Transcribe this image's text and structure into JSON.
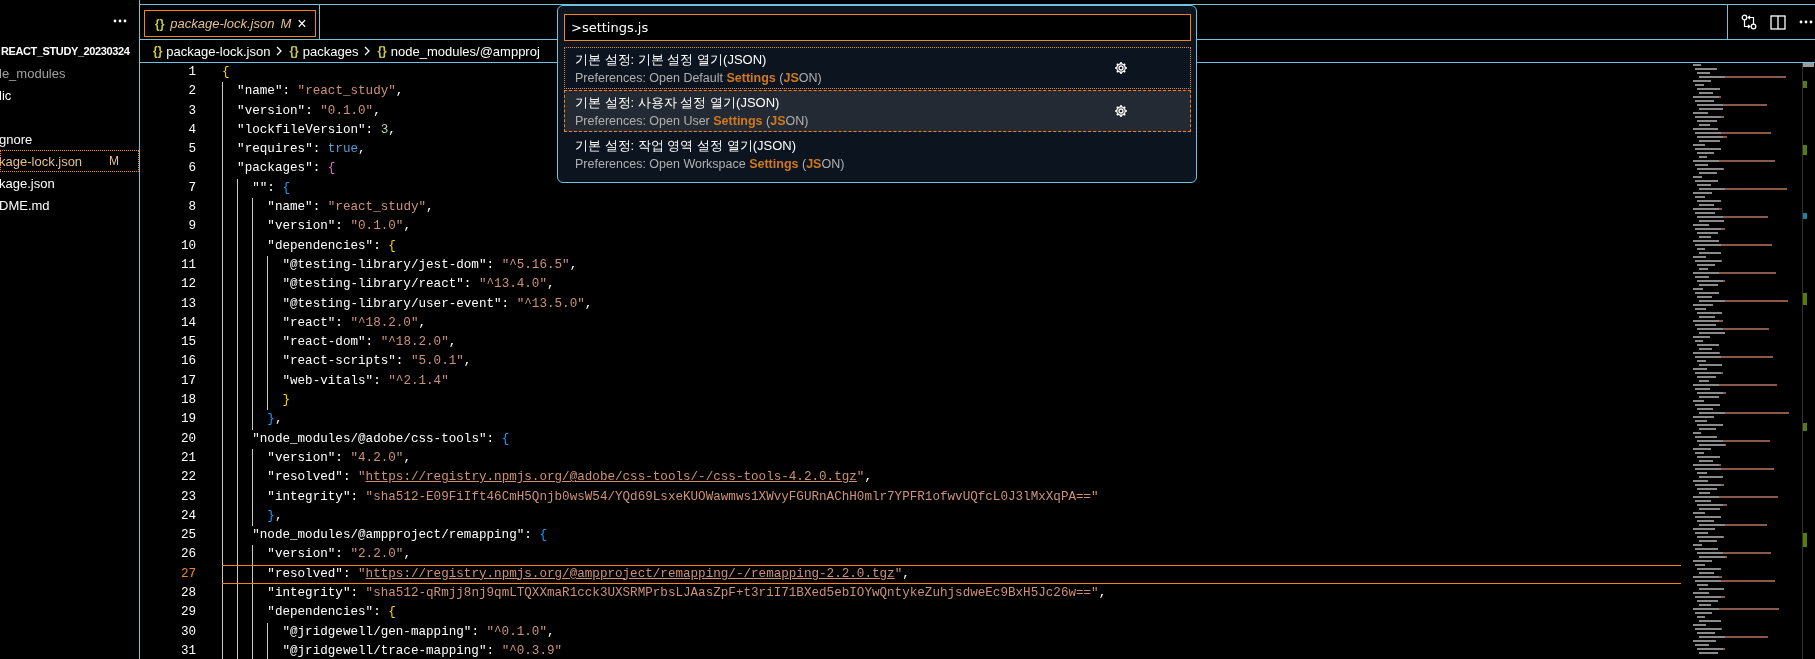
{
  "sidebar": {
    "title": "REACT_STUDY_20230324",
    "items": [
      {
        "label": "le_modules",
        "kind": "ignored",
        "selected": false
      },
      {
        "label": "lic",
        "kind": "plain",
        "selected": false
      },
      {
        "label": "gnore",
        "kind": "plain",
        "selected": false
      },
      {
        "label": "kage-lock.json",
        "kind": "modified",
        "badge": "M",
        "selected": true
      },
      {
        "label": "kage.json",
        "kind": "plain",
        "selected": false
      },
      {
        "label": "DME.md",
        "kind": "plain",
        "selected": false
      }
    ]
  },
  "tabs": [
    {
      "icon": "{}",
      "label": "package-lock.json",
      "badge": "M",
      "close": "×",
      "selected": true
    }
  ],
  "breadcrumbs": [
    {
      "icon": "{}",
      "label": "package-lock.json"
    },
    {
      "icon": "{}",
      "label": "packages"
    },
    {
      "icon": "{}",
      "label": "node_modules/@ampproj"
    }
  ],
  "editor": {
    "lines": [
      {
        "number": "1",
        "current": false,
        "tokens": [
          {
            "kind": "open",
            "text": "{"
          }
        ]
      },
      {
        "number": "2",
        "current": false,
        "tokens": [
          {
            "kind": "key",
            "text": "\"name\""
          },
          {
            "kind": "punct",
            "text": ": "
          },
          {
            "kind": "str",
            "text": "\"react_study\""
          },
          {
            "kind": "punct",
            "text": ","
          }
        ]
      },
      {
        "number": "3",
        "current": false,
        "tokens": [
          {
            "kind": "key",
            "text": "\"version\""
          },
          {
            "kind": "punct",
            "text": ": "
          },
          {
            "kind": "str",
            "text": "\"0.1.0\""
          },
          {
            "kind": "punct",
            "text": ","
          }
        ]
      },
      {
        "number": "4",
        "current": false,
        "tokens": [
          {
            "kind": "key",
            "text": "\"lockfileVersion\""
          },
          {
            "kind": "punct",
            "text": ": "
          },
          {
            "kind": "num",
            "text": "3"
          },
          {
            "kind": "punct",
            "text": ","
          }
        ]
      },
      {
        "number": "5",
        "current": false,
        "tokens": [
          {
            "kind": "key",
            "text": "\"requires\""
          },
          {
            "kind": "punct",
            "text": ": "
          },
          {
            "kind": "bool",
            "text": "true"
          },
          {
            "kind": "punct",
            "text": ","
          }
        ]
      },
      {
        "number": "6",
        "current": false,
        "tokens": [
          {
            "kind": "key",
            "text": "\"packages\""
          },
          {
            "kind": "punct",
            "text": ": "
          },
          {
            "kind": "open",
            "text": "{"
          }
        ]
      },
      {
        "number": "7",
        "current": false,
        "tokens": [
          {
            "kind": "key",
            "text": "\"\""
          },
          {
            "kind": "punct",
            "text": ": "
          },
          {
            "kind": "open",
            "text": "{"
          }
        ]
      },
      {
        "number": "8",
        "current": false,
        "tokens": [
          {
            "kind": "key",
            "text": "\"name\""
          },
          {
            "kind": "punct",
            "text": ": "
          },
          {
            "kind": "str",
            "text": "\"react_study\""
          },
          {
            "kind": "punct",
            "text": ","
          }
        ]
      },
      {
        "number": "9",
        "current": false,
        "tokens": [
          {
            "kind": "key",
            "text": "\"version\""
          },
          {
            "kind": "punct",
            "text": ": "
          },
          {
            "kind": "str",
            "text": "\"0.1.0\""
          },
          {
            "kind": "punct",
            "text": ","
          }
        ]
      },
      {
        "number": "10",
        "current": false,
        "tokens": [
          {
            "kind": "key",
            "text": "\"dependencies\""
          },
          {
            "kind": "punct",
            "text": ": "
          },
          {
            "kind": "open",
            "text": "{"
          }
        ]
      },
      {
        "number": "11",
        "current": false,
        "tokens": [
          {
            "kind": "key",
            "text": "\"@testing-library/jest-dom\""
          },
          {
            "kind": "punct",
            "text": ": "
          },
          {
            "kind": "str",
            "text": "\"^5.16.5\""
          },
          {
            "kind": "punct",
            "text": ","
          }
        ]
      },
      {
        "number": "12",
        "current": false,
        "tokens": [
          {
            "kind": "key",
            "text": "\"@testing-library/react\""
          },
          {
            "kind": "punct",
            "text": ": "
          },
          {
            "kind": "str",
            "text": "\"^13.4.0\""
          },
          {
            "kind": "punct",
            "text": ","
          }
        ]
      },
      {
        "number": "13",
        "current": false,
        "tokens": [
          {
            "kind": "key",
            "text": "\"@testing-library/user-event\""
          },
          {
            "kind": "punct",
            "text": ": "
          },
          {
            "kind": "str",
            "text": "\"^13.5.0\""
          },
          {
            "kind": "punct",
            "text": ","
          }
        ]
      },
      {
        "number": "14",
        "current": false,
        "tokens": [
          {
            "kind": "key",
            "text": "\"react\""
          },
          {
            "kind": "punct",
            "text": ": "
          },
          {
            "kind": "str",
            "text": "\"^18.2.0\""
          },
          {
            "kind": "punct",
            "text": ","
          }
        ]
      },
      {
        "number": "15",
        "current": false,
        "tokens": [
          {
            "kind": "key",
            "text": "\"react-dom\""
          },
          {
            "kind": "punct",
            "text": ": "
          },
          {
            "kind": "str",
            "text": "\"^18.2.0\""
          },
          {
            "kind": "punct",
            "text": ","
          }
        ]
      },
      {
        "number": "16",
        "current": false,
        "tokens": [
          {
            "kind": "key",
            "text": "\"react-scripts\""
          },
          {
            "kind": "punct",
            "text": ": "
          },
          {
            "kind": "str",
            "text": "\"5.0.1\""
          },
          {
            "kind": "punct",
            "text": ","
          }
        ]
      },
      {
        "number": "17",
        "current": false,
        "tokens": [
          {
            "kind": "key",
            "text": "\"web-vitals\""
          },
          {
            "kind": "punct",
            "text": ": "
          },
          {
            "kind": "str",
            "text": "\"^2.1.4\""
          }
        ]
      },
      {
        "number": "18",
        "current": false,
        "tokens": [
          {
            "kind": "close",
            "text": "}"
          }
        ]
      },
      {
        "number": "19",
        "current": false,
        "tokens": [
          {
            "kind": "close",
            "text": "}"
          },
          {
            "kind": "punct",
            "text": ","
          }
        ]
      },
      {
        "number": "20",
        "current": false,
        "tokens": [
          {
            "kind": "key",
            "text": "\"node_modules/@adobe/css-tools\""
          },
          {
            "kind": "punct",
            "text": ": "
          },
          {
            "kind": "open",
            "text": "{"
          }
        ]
      },
      {
        "number": "21",
        "current": false,
        "tokens": [
          {
            "kind": "key",
            "text": "\"version\""
          },
          {
            "kind": "punct",
            "text": ": "
          },
          {
            "kind": "str",
            "text": "\"4.2.0\""
          },
          {
            "kind": "punct",
            "text": ","
          }
        ]
      },
      {
        "number": "22",
        "current": false,
        "tokens": [
          {
            "kind": "key",
            "text": "\"resolved\""
          },
          {
            "kind": "punct",
            "text": ": "
          },
          {
            "kind": "str",
            "text": "\""
          },
          {
            "kind": "url",
            "text": "https://registry.npmjs.org/@adobe/css-tools/-/css-tools-4.2.0.tgz"
          },
          {
            "kind": "str",
            "text": "\""
          },
          {
            "kind": "punct",
            "text": ","
          }
        ]
      },
      {
        "number": "23",
        "current": false,
        "tokens": [
          {
            "kind": "key",
            "text": "\"integrity\""
          },
          {
            "kind": "punct",
            "text": ": "
          },
          {
            "kind": "str",
            "text": "\"sha512-E09FiIft46CmH5Qnjb0wsW54/YQd69LsxeKUOWawmws1XWvyFGURnAChH0mlr7YPFR1ofwvUQfcL0J3lMxXqPA==\""
          }
        ]
      },
      {
        "number": "24",
        "current": false,
        "tokens": [
          {
            "kind": "close",
            "text": "}"
          },
          {
            "kind": "punct",
            "text": ","
          }
        ]
      },
      {
        "number": "25",
        "current": false,
        "tokens": [
          {
            "kind": "key",
            "text": "\"node_modules/@ampproject/remapping\""
          },
          {
            "kind": "punct",
            "text": ": "
          },
          {
            "kind": "open",
            "text": "{"
          }
        ]
      },
      {
        "number": "26",
        "current": false,
        "tokens": [
          {
            "kind": "key",
            "text": "\"version\""
          },
          {
            "kind": "punct",
            "text": ": "
          },
          {
            "kind": "str",
            "text": "\"2.2.0\""
          },
          {
            "kind": "punct",
            "text": ","
          }
        ]
      },
      {
        "number": "27",
        "current": true,
        "tokens": [
          {
            "kind": "key",
            "text": "\"resolved\""
          },
          {
            "kind": "punct",
            "text": ": "
          },
          {
            "kind": "str",
            "text": "\""
          },
          {
            "kind": "url",
            "text": "https://registry.npmjs.org/@ampproject/remapping/-/remapping-2.2.0.tgz"
          },
          {
            "kind": "str",
            "text": "\""
          },
          {
            "kind": "punct",
            "text": ","
          }
        ]
      },
      {
        "number": "28",
        "current": false,
        "tokens": [
          {
            "kind": "key",
            "text": "\"integrity\""
          },
          {
            "kind": "punct",
            "text": ": "
          },
          {
            "kind": "str",
            "text": "\"sha512-qRmjj8nj9qmLTQXXmaR1cck3UXSRMPrbsLJAasZpF+t3riI71BXed5ebIOYwQntykeZuhjsdweEc9BxH5Jc26w==\""
          },
          {
            "kind": "punct",
            "text": ","
          }
        ]
      },
      {
        "number": "29",
        "current": false,
        "tokens": [
          {
            "kind": "key",
            "text": "\"dependencies\""
          },
          {
            "kind": "punct",
            "text": ": "
          },
          {
            "kind": "open",
            "text": "{"
          }
        ]
      },
      {
        "number": "30",
        "current": false,
        "tokens": [
          {
            "kind": "key",
            "text": "\"@jridgewell/gen-mapping\""
          },
          {
            "kind": "punct",
            "text": ": "
          },
          {
            "kind": "str",
            "text": "\"^0.1.0\""
          },
          {
            "kind": "punct",
            "text": ","
          }
        ]
      },
      {
        "number": "31",
        "current": false,
        "tokens": [
          {
            "kind": "key",
            "text": "\"@jridgewell/trace-mapping\""
          },
          {
            "kind": "punct",
            "text": ": "
          },
          {
            "kind": "str",
            "text": "\"^0.3.9\""
          }
        ]
      }
    ]
  },
  "command_palette": {
    "value": ">settings.js",
    "items": [
      {
        "title": "기본 설정: 기본 설정 열기(JSON)",
        "detail": "Preferences: Open Default **Settings** (**JS**ON)",
        "focused": true,
        "selected": false,
        "gear": true
      },
      {
        "title": "기본 설정: 사용자 설정 열기(JSON)",
        "detail": "Preferences: Open User **Settings** (**JS**ON)",
        "focused": false,
        "selected": true,
        "gear": true
      },
      {
        "title": "기본 설정: 작업 영역 설정 열기(JSON)",
        "detail": "Preferences: Open Workspace **Settings** (**JS**ON)",
        "focused": false,
        "selected": false,
        "gear": false
      }
    ]
  }
}
